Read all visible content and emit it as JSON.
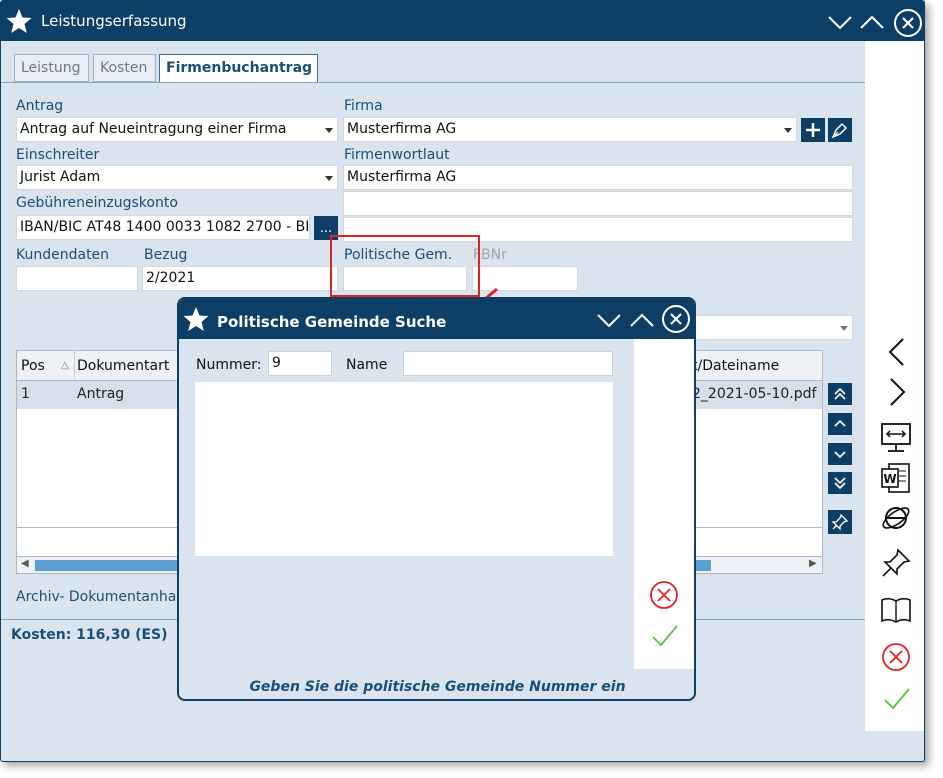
{
  "window": {
    "title": "Leistungserfassung"
  },
  "tabs": [
    {
      "label": "Leistung",
      "active": false
    },
    {
      "label": "Kosten",
      "active": false
    },
    {
      "label": "Firmenbuchantrag",
      "active": true
    }
  ],
  "form": {
    "antrag": {
      "label": "Antrag",
      "value": "Antrag auf Neueintragung einer Firma"
    },
    "firma": {
      "label": "Firma",
      "value": "Musterfirma AG"
    },
    "einschreiter": {
      "label": "Einschreiter",
      "value": "Jurist Adam"
    },
    "firmenwortlaut": {
      "label": "Firmenwortlaut",
      "value": "Musterfirma AG"
    },
    "gebuehrenkonto": {
      "label": "Gebühreneinzugskonto",
      "value": "IBAN/BIC AT48 1400 0033 1082 2700 - BI",
      "button": "..."
    },
    "kundendaten": {
      "label": "Kundendaten",
      "value": ""
    },
    "bezug": {
      "label": "Bezug",
      "value": "2/2021"
    },
    "politische_gem": {
      "label": "Politische Gem.",
      "value": ""
    },
    "fbnr": {
      "label": "FBNr",
      "value": ""
    }
  },
  "grid": {
    "columns": [
      "Pos",
      "Dokumentart",
      "t/Dateiname"
    ],
    "rows": [
      {
        "pos": "1",
        "dokumentart": "Antrag",
        "dateiname": "2_2021-05-10.pdf"
      }
    ]
  },
  "archive_label": "Archiv- Dokumentanhan",
  "status": {
    "kosten": "Kosten: 116,30 (ES)"
  },
  "dialog": {
    "title": "Politische Gemeinde Suche",
    "nummer_label": "Nummer:",
    "nummer_value": "9",
    "name_label": "Name",
    "name_value": "",
    "hint": "Geben Sie die politische Gemeinde Nummer ein"
  },
  "colors": {
    "primary": "#0d3f66",
    "background": "#d9e4ee",
    "accent_red": "#e02222",
    "ok_green": "#55c43a"
  }
}
